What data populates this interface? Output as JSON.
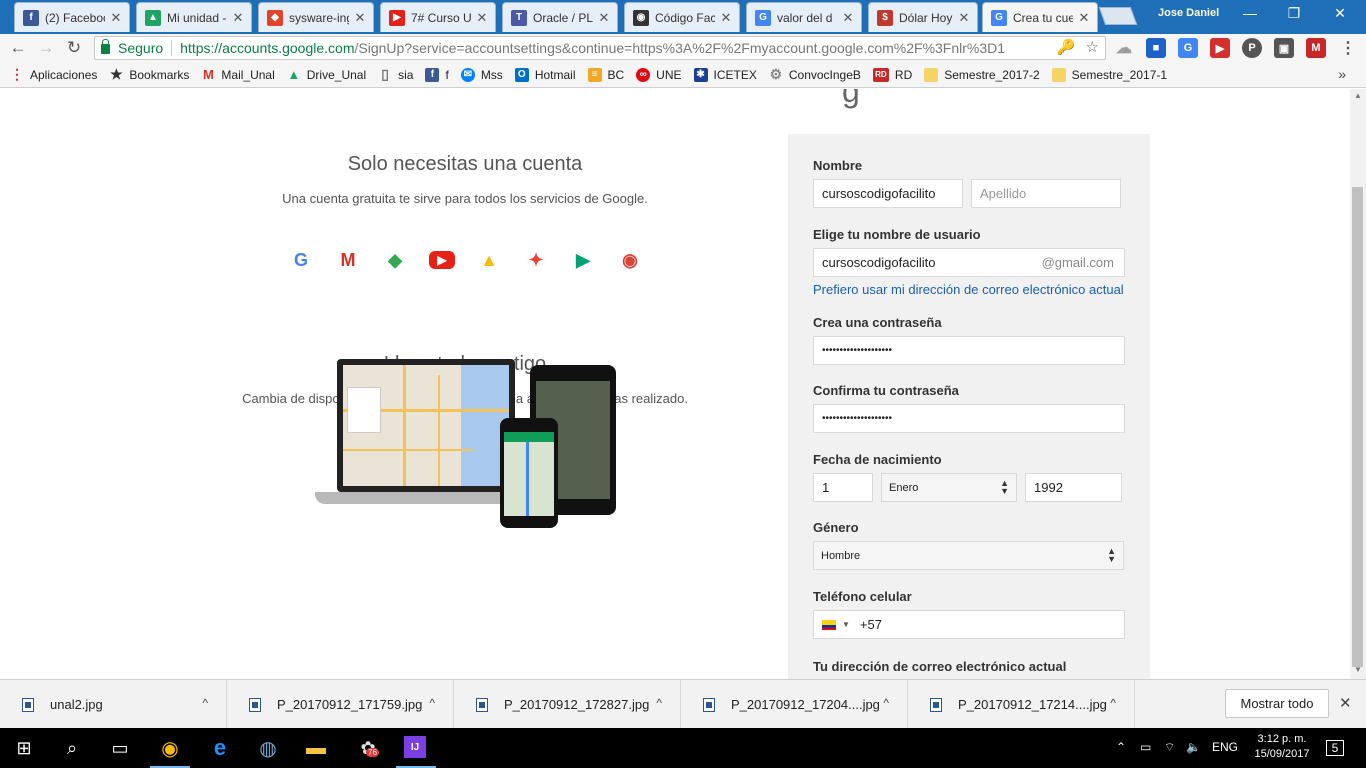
{
  "browser": {
    "tabs": [
      {
        "title": "(2) Faceboo",
        "icon_text": "f",
        "icon_color": "#3b5998"
      },
      {
        "title": "Mi unidad -",
        "icon_text": "▲",
        "icon_color": "#1fa463"
      },
      {
        "title": "sysware-ing",
        "icon_text": "◆",
        "icon_color": "#e24329"
      },
      {
        "title": "7# Curso U",
        "icon_text": "▶",
        "icon_color": "#e62117"
      },
      {
        "title": "Oracle / PL",
        "icon_text": "T",
        "icon_color": "#4a5aa8"
      },
      {
        "title": "Código Fac",
        "icon_text": "◉",
        "icon_color": "#333333"
      },
      {
        "title": "valor del d",
        "icon_text": "G",
        "icon_color": "#4285f4"
      },
      {
        "title": "Dólar Hoy",
        "icon_text": "$",
        "icon_color": "#c0392b"
      },
      {
        "title": "Crea tu cue",
        "icon_text": "G",
        "icon_color": "#4285f4"
      }
    ],
    "profile_name": "Jose Daniel",
    "window_controls": {
      "minimize": "—",
      "restore": "❐",
      "close": "✕"
    },
    "nav": {
      "back": "←",
      "forward": "→",
      "reload": "↻"
    },
    "secure_label": "Seguro",
    "url_host": "https://accounts.google.com",
    "url_rest": "/SignUp?service=accountsettings&continue=https%3A%2F%2Fmyaccount.google.com%2F%3Fnlr%3D1",
    "omnibox_icons": {
      "key": "🔑",
      "star": "☆"
    },
    "extensions": [
      {
        "name": "cloud-extension-icon",
        "text": "☁",
        "color": "#9e9e9e"
      },
      {
        "name": "folder-extension-icon",
        "text": "■",
        "color": "#1e62c7"
      },
      {
        "name": "translate-extension-icon",
        "text": "G",
        "color": "#4285f4"
      },
      {
        "name": "video-extension-icon",
        "text": "▶",
        "color": "#d32f2f"
      },
      {
        "name": "pinterest-extension-icon",
        "text": "P",
        "color": "#555555"
      },
      {
        "name": "lock-extension-icon",
        "text": "▣",
        "color": "#555555"
      },
      {
        "name": "m-extension-icon",
        "text": "M",
        "color": "#c62828"
      }
    ],
    "menu_icon": "⋮",
    "bookmarks": [
      {
        "label": "Aplicaciones",
        "icon": "apps",
        "text": "⋮",
        "color": "#d32f2f"
      },
      {
        "label": "Bookmarks",
        "icon": "star",
        "text": "★",
        "color": "#333333"
      },
      {
        "label": "Mail_Unal",
        "icon": "gmail",
        "text": "M",
        "color": "#d93025"
      },
      {
        "label": "Drive_Unal",
        "icon": "drive",
        "text": "▲",
        "color": "#1fa463"
      },
      {
        "label": "sia",
        "icon": "page",
        "text": "▯",
        "color": "#777777"
      },
      {
        "label": "f",
        "icon": "facebook",
        "text": "f",
        "color": "#3b5998"
      },
      {
        "label": "Mss",
        "icon": "messenger",
        "text": "✉",
        "color": "#0084ff"
      },
      {
        "label": "Hotmail",
        "icon": "outlook",
        "text": "O",
        "color": "#0072c6"
      },
      {
        "label": "BC",
        "icon": "bancolombia",
        "text": "≡",
        "color": "#f5a623"
      },
      {
        "label": "UNE",
        "icon": "une",
        "text": "∞",
        "color": "#e30613"
      },
      {
        "label": "ICETEX",
        "icon": "icetex",
        "text": "✱",
        "color": "#1c3f94"
      },
      {
        "label": "ConvocIngeB",
        "icon": "gear",
        "text": "⚙",
        "color": "#888888"
      },
      {
        "label": "RD",
        "icon": "rd",
        "text": "RD",
        "color": "#c62828"
      },
      {
        "label": "Semestre_2017-2",
        "icon": "folder",
        "text": "",
        "color": "#f6d365"
      },
      {
        "label": "Semestre_2017-1",
        "icon": "folder",
        "text": "",
        "color": "#f6d365"
      }
    ],
    "bookmarks_more": "»"
  },
  "page": {
    "logo_fragment": "g",
    "hero1": {
      "title": "Solo necesitas una cuenta",
      "subtitle": "Una cuenta gratuita te sirve para todos los servicios de Google."
    },
    "services": [
      {
        "name": "google-icon",
        "text": "G",
        "color": "#4285f4"
      },
      {
        "name": "gmail-icon",
        "text": "M",
        "color": "#d93025"
      },
      {
        "name": "maps-icon",
        "text": "◆",
        "color": "#34a853"
      },
      {
        "name": "youtube-icon",
        "text": "▶",
        "color": "#e62117"
      },
      {
        "name": "drive-icon",
        "text": "▲",
        "color": "#fbbc05"
      },
      {
        "name": "photos-icon",
        "text": "✦",
        "color": "#ea4335"
      },
      {
        "name": "play-icon",
        "text": "▶",
        "color": "#00a173"
      },
      {
        "name": "chrome-icon",
        "text": "◉",
        "color": "#db4437"
      }
    ],
    "hero2": {
      "title": "Lleva todo contigo",
      "subtitle": "Cambia de dispositivo y continúa desde la última acción que hayas realizado."
    },
    "form": {
      "name_label": "Nombre",
      "first_name": "cursoscodigofacilito",
      "last_name_placeholder": "Apellido",
      "username_label": "Elige tu nombre de usuario",
      "username": "cursoscodigofacilito",
      "username_suffix": "@gmail.com",
      "use_email_link": "Prefiero usar mi dirección de correo electrónico actual",
      "password_label": "Crea una contraseña",
      "password_mask": "••••••••••••••••••••",
      "confirm_label": "Confirma tu contraseña",
      "confirm_mask": "••••••••••••••••••••",
      "birth_label": "Fecha de nacimiento",
      "birth_day": "1",
      "birth_month": "Enero",
      "birth_year": "1992",
      "gender_label": "Género",
      "gender": "Hombre",
      "phone_label": "Teléfono celular",
      "phone_code": "+57",
      "email_label": "Tu dirección de correo electrónico actual"
    }
  },
  "downloads": {
    "items": [
      "unal2.jpg",
      "P_20170912_171759.jpg",
      "P_20170912_172827.jpg",
      "P_20170912_17204....jpg",
      "P_20170912_17214....jpg"
    ],
    "expand_glyph": "^",
    "show_all": "Mostrar todo",
    "close": "✕"
  },
  "taskbar": {
    "start": "⊞",
    "search": "⌕",
    "task_view": "▭",
    "apps": [
      {
        "name": "chrome-taskbar-icon",
        "text": "◉",
        "color": "#fbbc05"
      },
      {
        "name": "edge-taskbar-icon",
        "text": "e",
        "color": "#1e90ff"
      },
      {
        "name": "network-taskbar-icon",
        "text": "◍",
        "color": "#6fa8dc"
      },
      {
        "name": "explorer-taskbar-icon",
        "text": "▬",
        "color": "#f6c344"
      },
      {
        "name": "badge-app-taskbar-icon",
        "text": "✿",
        "color": "#e0e0e0"
      },
      {
        "name": "intellij-taskbar-icon",
        "text": "IJ",
        "color": "#7b3fe4"
      }
    ],
    "badge_count": "76",
    "language": "ENG",
    "time": "3:12 p. m.",
    "date": "15/09/2017",
    "notifications": "5",
    "tray_glyphs": {
      "chevron": "⌃",
      "battery": "▭",
      "wifi": "⌔",
      "volume": "🔈"
    }
  }
}
